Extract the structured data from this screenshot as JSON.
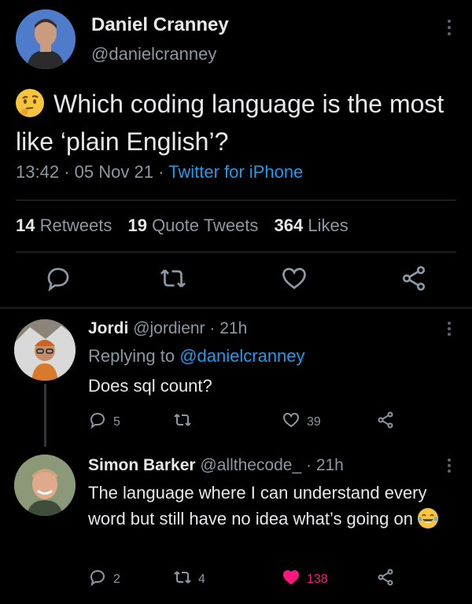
{
  "main_tweet": {
    "author_name": "Daniel Cranney",
    "author_handle": "@danielcranney",
    "text": "Which coding language is the most like ‘plain English’?",
    "time": "13:42",
    "date": "05 Nov 21",
    "source": "Twitter for iPhone",
    "retweets": "14",
    "retweets_label": "Retweets",
    "quotes": "19",
    "quotes_label": "Quote Tweets",
    "likes": "364",
    "likes_label": "Likes",
    "emoji_icon": "thinking-face-icon"
  },
  "replies": [
    {
      "name": "Jordi",
      "handle": "@jordienr",
      "age": "21h",
      "replying_to_label": "Replying to",
      "replying_to": "@danielcranney",
      "text": "Does sql count?",
      "reply_count": "5",
      "retweet_count": "",
      "like_count": "39",
      "liked": false
    },
    {
      "name": "Simon Barker",
      "handle": "@allthecode_",
      "age": "21h",
      "text": "The language where I can understand every word but still have no idea what’s going on",
      "emoji_icon": "tears-of-joy-icon",
      "reply_count": "2",
      "retweet_count": "4",
      "like_count": "138",
      "liked": true
    }
  ],
  "colors": {
    "background": "#000000",
    "text": "#e7e9ea",
    "muted": "#8b98a5",
    "link": "#1d9bf0",
    "like": "#f91880"
  }
}
